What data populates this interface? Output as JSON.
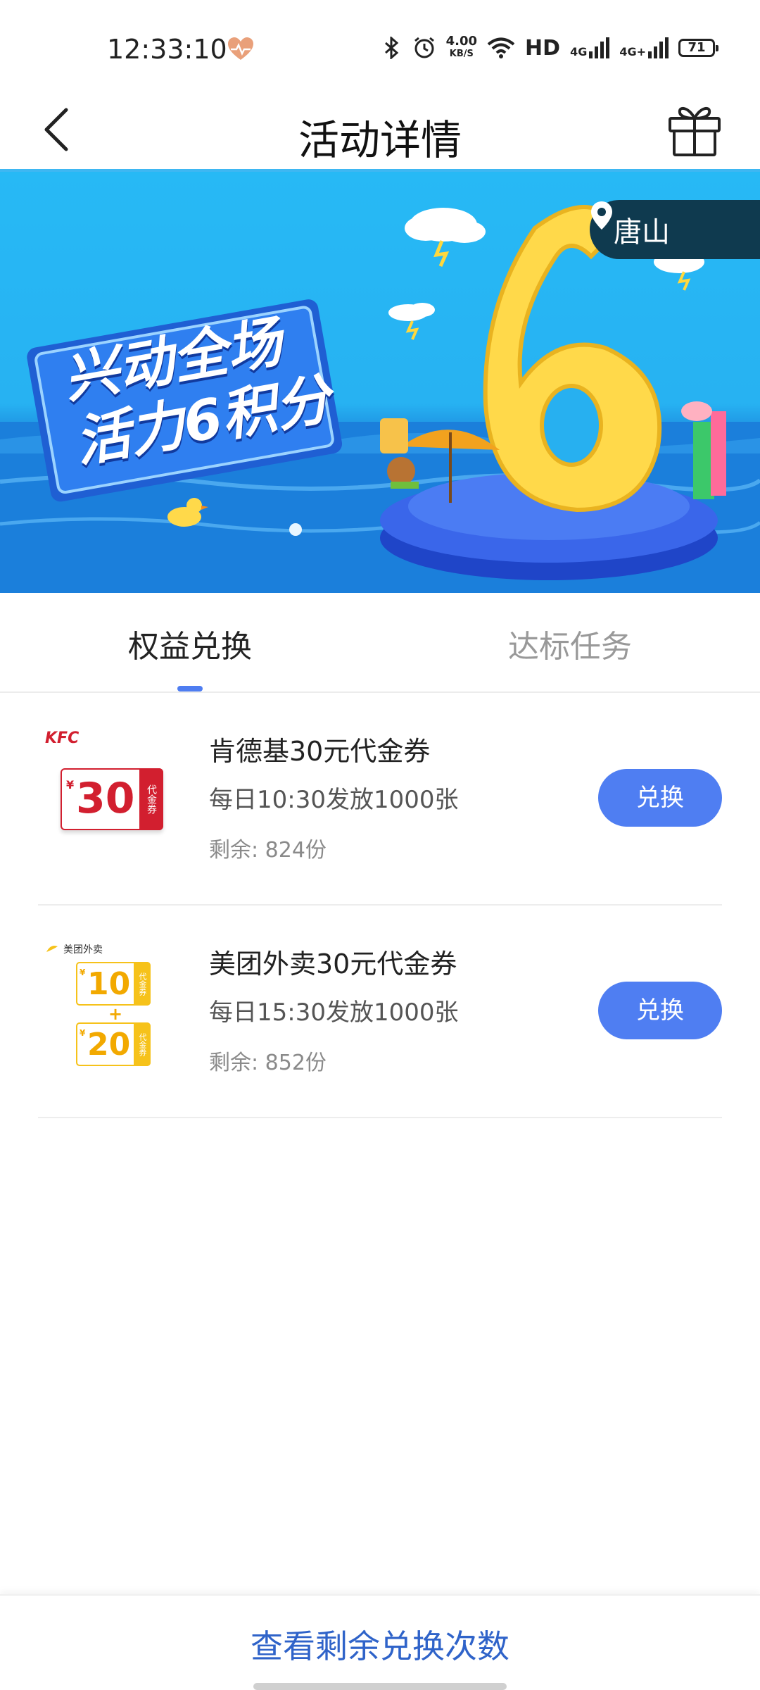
{
  "status_bar": {
    "time": "12:33:10",
    "net_speed_value": "4.00",
    "net_speed_unit": "KB/S",
    "hd_label": "HD",
    "signal_1_label": "4G",
    "signal_2_label": "4G+",
    "battery": "71"
  },
  "header": {
    "title": "活动详情",
    "back_icon": "chevron-left-icon",
    "gift_icon": "gift-icon"
  },
  "banner": {
    "headline_line1": "兴动全场",
    "headline_line2": "活力6积分",
    "big_number": "6",
    "location": "唐山"
  },
  "tabs": [
    {
      "label": "权益兑换",
      "active": true
    },
    {
      "label": "达标任务",
      "active": false
    }
  ],
  "items": [
    {
      "title": "肯德基30元代金券",
      "schedule": "每日10:30发放1000张",
      "remaining": "剩余: 824份",
      "button": "兑换",
      "thumb": {
        "brand": "KFC",
        "currency": "¥",
        "amount": "30",
        "tag": "代金券"
      }
    },
    {
      "title": "美团外卖30元代金券",
      "schedule": "每日15:30发放1000张",
      "remaining": "剩余: 852份",
      "button": "兑换",
      "thumb": {
        "brand": "美团外卖",
        "currency": "¥",
        "amount1": "10",
        "plus": "+",
        "amount2": "20",
        "tag": "代金券"
      }
    }
  ],
  "bottom": {
    "link": "查看剩余兑换次数"
  },
  "colors": {
    "accent": "#4f7ef2",
    "link": "#2f63c9",
    "banner_sky": "#27b9f5",
    "kfc_red": "#d21f2f",
    "meituan_yellow": "#f6c21a"
  }
}
